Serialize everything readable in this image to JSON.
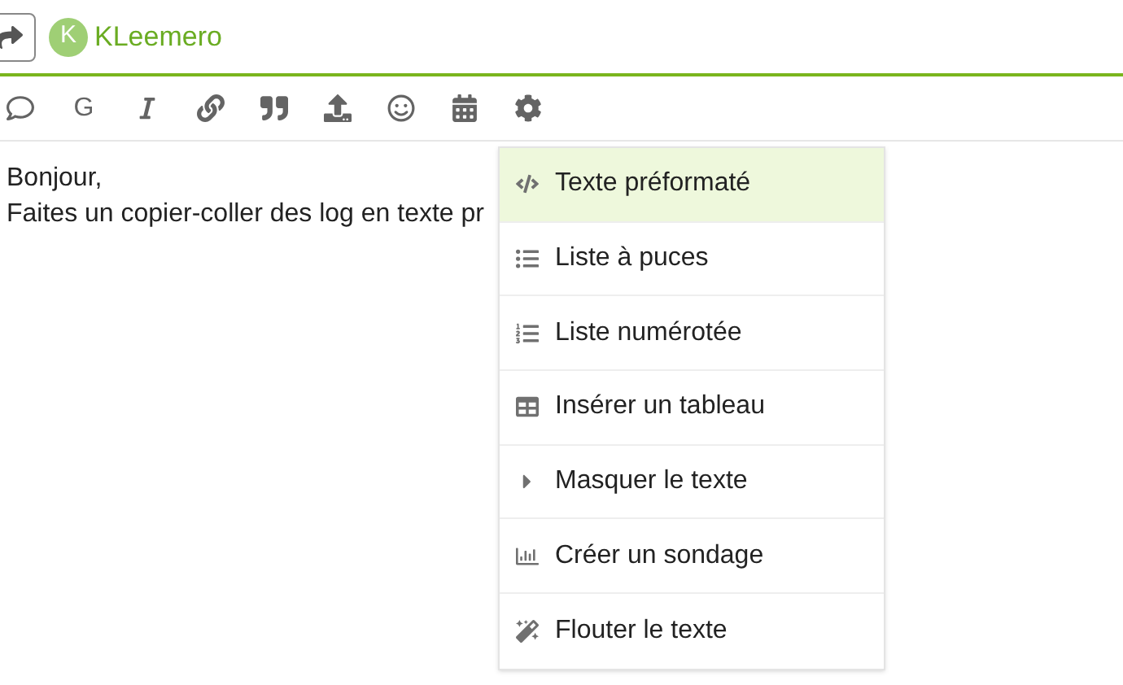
{
  "header": {
    "avatar_letter": "K",
    "username": "KLeemero"
  },
  "toolbar": {
    "bold_label": "G"
  },
  "editor": {
    "lines": [
      "Bonjour,",
      "Faites un copier-coller des log en texte pr"
    ]
  },
  "menu": {
    "items": [
      {
        "label": "Texte préformaté",
        "selected": true
      },
      {
        "label": "Liste à puces",
        "selected": false
      },
      {
        "label": "Liste numérotée",
        "selected": false
      },
      {
        "label": "Insérer un tableau",
        "selected": false
      },
      {
        "label": "Masquer le texte",
        "selected": false
      },
      {
        "label": "Créer un sondage",
        "selected": false
      },
      {
        "label": "Flouter le texte",
        "selected": false
      }
    ]
  }
}
